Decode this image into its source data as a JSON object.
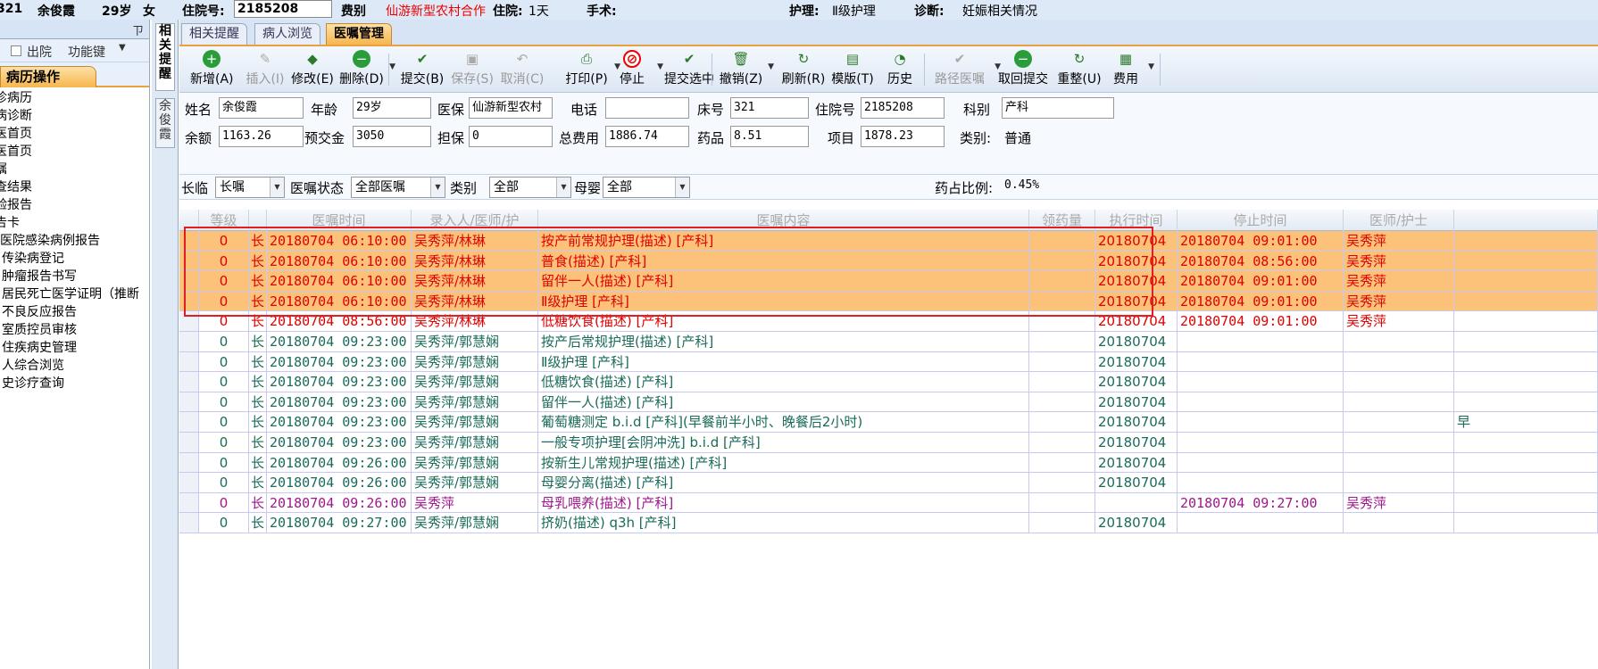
{
  "topbar": {
    "bed_fragment": "321",
    "name": "余俊霞",
    "age": "29岁",
    "gender": "女",
    "admission_label": "住院号:",
    "admission_no": "2185208",
    "fee_type_label": "费别",
    "fee_type_value": "仙游新型农村合作",
    "days_label": "住院:",
    "days_value": "1天",
    "surgery_label": "手术:",
    "nursing_label": "护理:",
    "nursing_value": "Ⅱ级护理",
    "diagnosis_label": "诊断:",
    "diagnosis_value": "妊娠相关情况"
  },
  "sidebar": {
    "pin": "ㄗ",
    "discharge_label": "出院",
    "function_key": "功能键",
    "dropdown_arrow": "▼",
    "tab": "病历操作",
    "items": [
      "诊病历",
      "病诊断",
      "医首页",
      "医首页",
      "嘱",
      "查结果",
      "验报告",
      "告卡",
      "医院感染病例报告",
      "传染病登记",
      "肿瘤报告书写",
      "居民死亡医学证明（推断",
      "不良反应报告",
      "室质控员审核",
      "住疾病史管理",
      "人综合浏览",
      "史诊疗查询"
    ]
  },
  "vertical_tabs": [
    "相关提醒",
    "余俊霞"
  ],
  "tabs": [
    {
      "label": "相关提醒",
      "active": false
    },
    {
      "label": "病人浏览",
      "active": false
    },
    {
      "label": "医嘱管理",
      "active": true
    }
  ],
  "toolbar": {
    "buttons": [
      {
        "label": "新增(A)",
        "icon": "add-icon",
        "glyph": "+",
        "enabled": true
      },
      {
        "label": "插入(I)",
        "icon": "insert-icon",
        "glyph": "✎",
        "enabled": false
      },
      {
        "label": "修改(E)",
        "icon": "edit-icon",
        "glyph": "◆",
        "enabled": true
      },
      {
        "label": "删除(D)",
        "icon": "delete-icon",
        "glyph": "−",
        "enabled": true,
        "dropdown": true
      },
      {
        "label": "提交(B)",
        "icon": "submit-icon",
        "glyph": "✔",
        "enabled": true
      },
      {
        "label": "保存(S)",
        "icon": "save-icon",
        "glyph": "▣",
        "enabled": false
      },
      {
        "label": "取消(C)",
        "icon": "cancel-icon",
        "glyph": "↶",
        "enabled": false
      },
      {
        "label": "打印(P)",
        "icon": "print-icon",
        "glyph": "⎙",
        "enabled": true,
        "dropdown": true
      },
      {
        "label": "停止",
        "icon": "stop-icon",
        "glyph": "⊘",
        "enabled": true,
        "dropdown": true
      },
      {
        "label": "提交选中",
        "icon": "submit-selected-icon",
        "glyph": "✔",
        "enabled": true
      },
      {
        "label": "撤销(Z)",
        "icon": "revoke-icon",
        "glyph": "🗑",
        "enabled": true,
        "dropdown": true
      },
      {
        "label": "刷新(R)",
        "icon": "refresh-icon",
        "glyph": "↻",
        "enabled": true
      },
      {
        "label": "模版(T)",
        "icon": "template-icon",
        "glyph": "▤",
        "enabled": true
      },
      {
        "label": "历史",
        "icon": "history-icon",
        "glyph": "◔",
        "enabled": true
      },
      {
        "label": "路径医嘱",
        "icon": "pathway-icon",
        "glyph": "✔",
        "enabled": false,
        "dropdown": true
      },
      {
        "label": "取回提交",
        "icon": "retrieve-icon",
        "glyph": "−",
        "enabled": true
      },
      {
        "label": "重整(U)",
        "icon": "reorganize-icon",
        "glyph": "↻",
        "enabled": true
      },
      {
        "label": "费用",
        "icon": "fee-icon",
        "glyph": "▦",
        "enabled": true,
        "dropdown": true
      }
    ]
  },
  "patient": {
    "name_label": "姓名",
    "name": "余俊霞",
    "age_label": "年龄",
    "age": "29岁",
    "insurance_label": "医保",
    "insurance": "仙游新型农村",
    "phone_label": "电话",
    "phone": "",
    "bed_label": "床号",
    "bed": "321",
    "admission_label": "住院号",
    "admission": "2185208",
    "dept_label": "科别",
    "dept": "产科",
    "balance_label": "余额",
    "balance": "1163.26",
    "deposit_label": "预交金",
    "deposit": "3050",
    "guarantee_label": "担保",
    "guarantee": "0",
    "total_label": "总费用",
    "total": "1886.74",
    "drug_label": "药品",
    "drug": "8.51",
    "item_label": "项目",
    "item": "1878.23",
    "category_label": "类别:",
    "category": "普通"
  },
  "filters": {
    "duration_label": "长临",
    "duration": "长嘱",
    "status_label": "医嘱状态",
    "status": "全部医嘱",
    "type_label": "类别",
    "type": "全部",
    "mother_baby_label": "母婴",
    "mother_baby": "全部",
    "drug_ratio_label": "药占比例:",
    "drug_ratio": "0.45%"
  },
  "grid": {
    "columns": [
      "等级",
      "",
      "医嘱时间",
      "录入人/医师/护",
      "医嘱内容",
      "领药量",
      "执行时间",
      "停止时间",
      "医师/护士"
    ],
    "rows": [
      {
        "level": "0",
        "type": "长",
        "time": "20180704 06:10:00",
        "staff": "吴秀萍/林琳",
        "content": "按产前常规护理(描述)   [产科]",
        "exec": "20180704",
        "stop": "20180704 09:01:00",
        "nurse": "吴秀萍",
        "style": "hl"
      },
      {
        "level": "0",
        "type": "长",
        "time": "20180704 06:10:00",
        "staff": "吴秀萍/林琳",
        "content": "普食(描述)   [产科]",
        "exec": "20180704",
        "stop": "20180704 08:56:00",
        "nurse": "吴秀萍",
        "style": "hl"
      },
      {
        "level": "0",
        "type": "长",
        "time": "20180704 06:10:00",
        "staff": "吴秀萍/林琳",
        "content": "留伴一人(描述)   [产科]",
        "exec": "20180704",
        "stop": "20180704 09:01:00",
        "nurse": "吴秀萍",
        "style": "hl"
      },
      {
        "level": "0",
        "type": "长",
        "time": "20180704 06:10:00",
        "staff": "吴秀萍/林琳",
        "content": "Ⅱ级护理   [产科]",
        "exec": "20180704",
        "stop": "20180704 09:01:00",
        "nurse": "吴秀萍",
        "style": "hl"
      },
      {
        "level": "0",
        "type": "长",
        "time": "20180704 08:56:00",
        "staff": "吴秀萍/林琳",
        "content": "低糖饮食(描述)   [产科]",
        "exec": "20180704",
        "stop": "20180704 09:01:00",
        "nurse": "吴秀萍",
        "style": "red"
      },
      {
        "level": "0",
        "type": "长",
        "time": "20180704 09:23:00",
        "staff": "吴秀萍/郭慧娴",
        "content": "按产后常规护理(描述)   [产科]",
        "exec": "20180704",
        "stop": "",
        "nurse": "",
        "style": "green"
      },
      {
        "level": "0",
        "type": "长",
        "time": "20180704 09:23:00",
        "staff": "吴秀萍/郭慧娴",
        "content": "Ⅱ级护理   [产科]",
        "exec": "20180704",
        "stop": "",
        "nurse": "",
        "style": "green"
      },
      {
        "level": "0",
        "type": "长",
        "time": "20180704 09:23:00",
        "staff": "吴秀萍/郭慧娴",
        "content": "低糖饮食(描述)   [产科]",
        "exec": "20180704",
        "stop": "",
        "nurse": "",
        "style": "green"
      },
      {
        "level": "0",
        "type": "长",
        "time": "20180704 09:23:00",
        "staff": "吴秀萍/郭慧娴",
        "content": "留伴一人(描述)   [产科]",
        "exec": "20180704",
        "stop": "",
        "nurse": "",
        "style": "green"
      },
      {
        "level": "0",
        "type": "长",
        "time": "20180704 09:23:00",
        "staff": "吴秀萍/郭慧娴",
        "content": "葡萄糖测定 b.i.d  [产科](早餐前半小时、晚餐后2小时)",
        "exec": "20180704",
        "stop": "",
        "nurse": "",
        "extra": "早",
        "style": "green"
      },
      {
        "level": "0",
        "type": "长",
        "time": "20180704 09:23:00",
        "staff": "吴秀萍/郭慧娴",
        "content": "一般专项护理[会阴冲洗] b.i.d  [产科]",
        "exec": "20180704",
        "stop": "",
        "nurse": "",
        "style": "green"
      },
      {
        "level": "0",
        "type": "长",
        "time": "20180704 09:26:00",
        "staff": "吴秀萍/郭慧娴",
        "content": "按新生儿常规护理(描述)   [产科]",
        "exec": "20180704",
        "stop": "",
        "nurse": "",
        "style": "green"
      },
      {
        "level": "0",
        "type": "长",
        "time": "20180704 09:26:00",
        "staff": "吴秀萍/郭慧娴",
        "content": "母婴分离(描述)   [产科]",
        "exec": "20180704",
        "stop": "",
        "nurse": "",
        "style": "green"
      },
      {
        "level": "0",
        "type": "长",
        "time": "20180704 09:26:00",
        "staff": "吴秀萍",
        "content": "母乳喂养(描述)   [产科]",
        "exec": "",
        "stop": "20180704 09:27:00",
        "nurse": "吴秀萍",
        "style": "purple"
      },
      {
        "level": "0",
        "type": "长",
        "time": "20180704 09:27:00",
        "staff": "吴秀萍/郭慧娴",
        "content": "挤奶(描述) q3h  [产科]",
        "exec": "20180704",
        "stop": "",
        "nurse": "",
        "style": "green"
      }
    ]
  },
  "colors": {
    "red": "#e00000",
    "green": "#1a6b5a",
    "purple": "#a0168c",
    "highlight": "#fdc27a",
    "selection": "#e02020"
  }
}
